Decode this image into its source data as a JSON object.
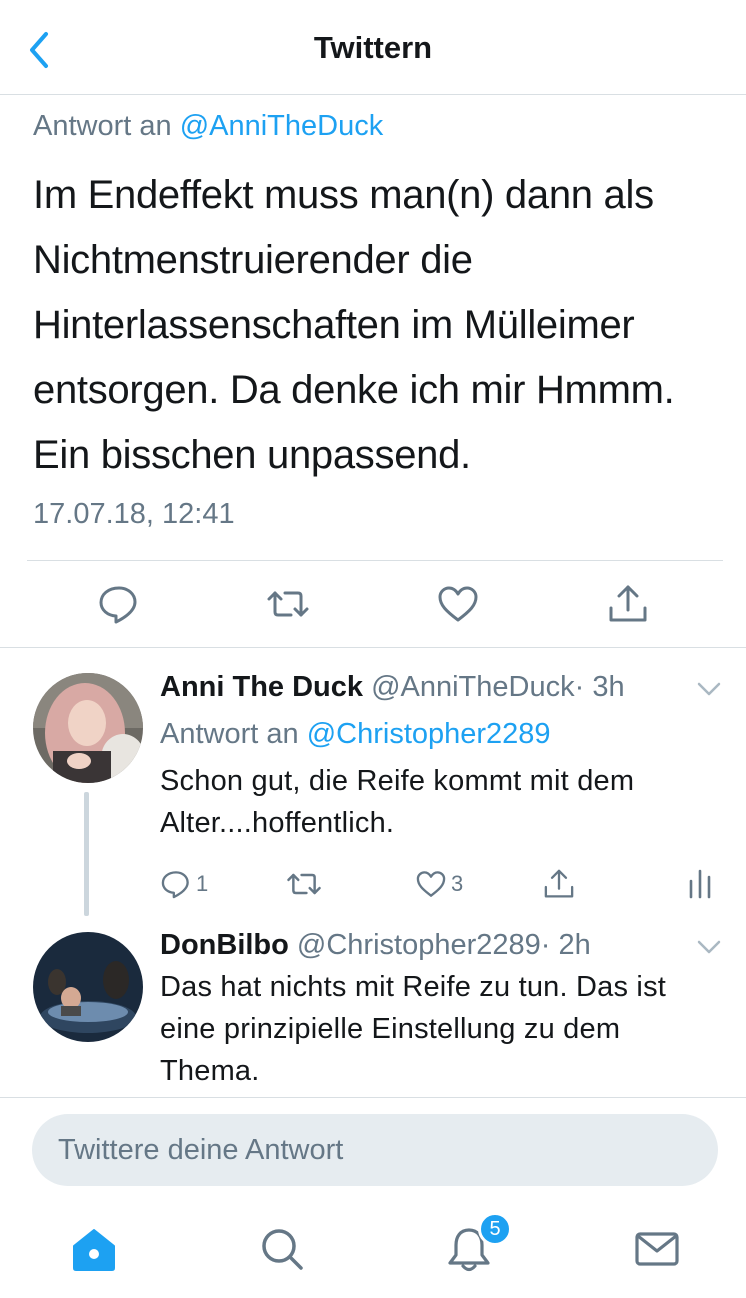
{
  "header": {
    "title": "Twittern",
    "back_icon": "chevron-left-icon"
  },
  "main_tweet": {
    "reply_prefix": "Antwort an",
    "reply_mention": "@AnniTheDuck",
    "text": "Im Endeffekt muss man(n) dann als Nichtmenstruierender die Hinterlassenschaften im Mülleimer entsorgen. Da denke ich mir Hmmm. Ein bisschen unpassend.",
    "timestamp": "17.07.18, 12:41",
    "actions": [
      "reply-icon",
      "retweet-icon",
      "like-icon",
      "share-icon"
    ]
  },
  "replies": [
    {
      "name": "Anni The Duck",
      "handle": "@AnniTheDuck",
      "time": "· 3h",
      "reply_prefix": "Antwort an",
      "reply_mention": "@Christopher2289",
      "text": "Schon gut, die Reife kommt mit dem Alter....hoffentlich.",
      "reply_count": "1",
      "like_count": "3"
    },
    {
      "name": "DonBilbo",
      "handle": "@Christopher2289",
      "time": "· 2h",
      "text": "Das hat nichts mit Reife zu tun. Das ist eine prinzipielle Einstellung zu dem Thema."
    }
  ],
  "compose": {
    "placeholder": "Twittere deine Antwort"
  },
  "tabbar": {
    "items": [
      "home-icon",
      "search-icon",
      "notifications-icon",
      "messages-icon"
    ],
    "notification_badge": "5"
  },
  "colors": {
    "accent": "#1da1f2",
    "secondary_text": "#657786",
    "divider": "#d9dfe3",
    "compose_bg": "#e6ecf0"
  }
}
